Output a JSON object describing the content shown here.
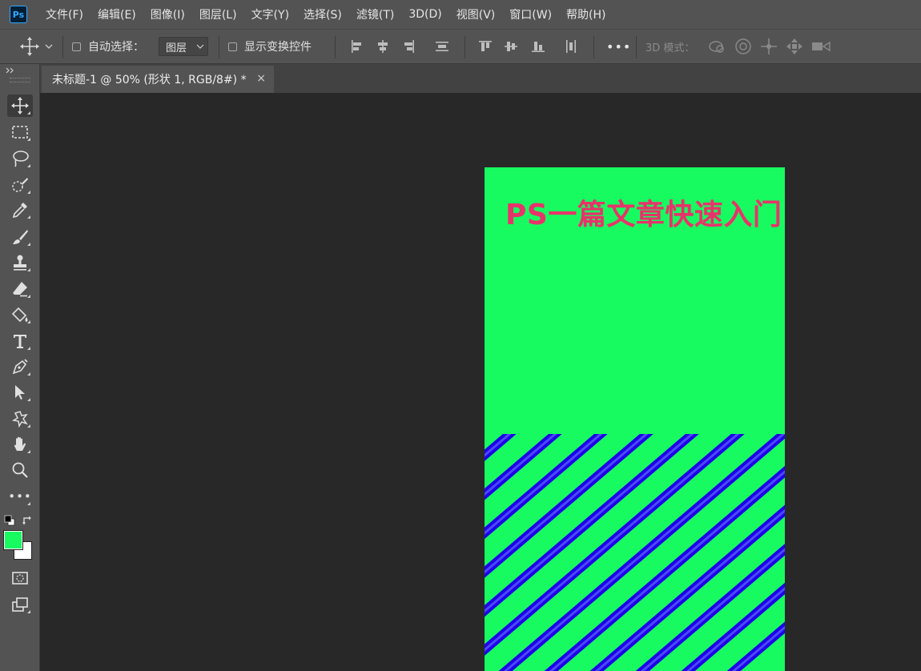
{
  "app": {
    "logo_text": "Ps"
  },
  "menu": [
    {
      "label": "文件(F)"
    },
    {
      "label": "编辑(E)"
    },
    {
      "label": "图像(I)"
    },
    {
      "label": "图层(L)"
    },
    {
      "label": "文字(Y)"
    },
    {
      "label": "选择(S)"
    },
    {
      "label": "滤镜(T)"
    },
    {
      "label": "3D(D)"
    },
    {
      "label": "视图(V)"
    },
    {
      "label": "窗口(W)"
    },
    {
      "label": "帮助(H)"
    }
  ],
  "options": {
    "auto_select_label": "自动选择：",
    "auto_select_checked": false,
    "layer_select_value": "图层",
    "show_transform_label": "显示变换控件",
    "show_transform_checked": false,
    "more_label": "•••",
    "mode_label": "3D 模式："
  },
  "document": {
    "tab_title": "未标题-1 @ 50% (形状 1, RGB/8#) *",
    "close_label": "×",
    "canvas_text": "PS一篇文章快速入门",
    "canvas_color": "#17fb61",
    "text_color": "#e8336a",
    "stripe_color": "#1f00e8"
  },
  "colors": {
    "foreground": "#17fb61",
    "background": "#ffffff"
  },
  "toolbox": {
    "more_label": "•••"
  }
}
